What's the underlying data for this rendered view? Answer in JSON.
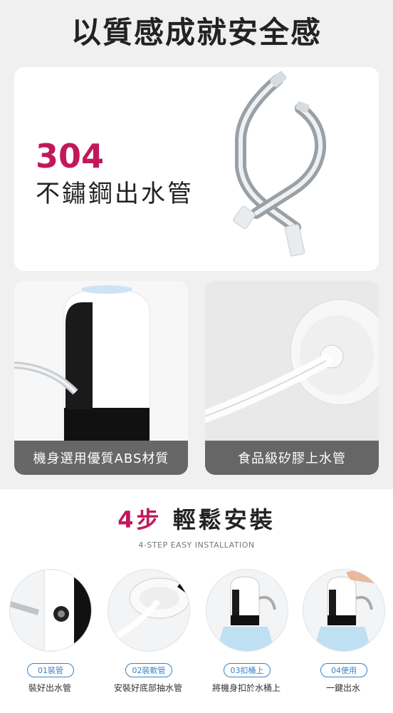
{
  "headline": "以質感成就安全感",
  "feature1": {
    "number": "304",
    "label": "不鏽鋼出水管"
  },
  "feature2": {
    "caption": "機身選用優質ABS材質"
  },
  "feature3": {
    "caption": "食品級矽膠上水管"
  },
  "install": {
    "title_num": "4步",
    "title_rest": " 輕鬆安裝",
    "subtitle": "4-STEP EASY INSTALLATION",
    "steps": [
      {
        "tag": "01裝管",
        "desc": "裝好出水管"
      },
      {
        "tag": "02裝軟管",
        "desc": "安裝好底部抽水管"
      },
      {
        "tag": "03扣桶上",
        "desc": "將機身扣於水桶上"
      },
      {
        "tag": "04使用",
        "desc": "一鍵出水"
      }
    ]
  },
  "colors": {
    "accent": "#c2185b",
    "step_blue": "#3b82c4",
    "caption_bg": "#5a5a5a"
  }
}
